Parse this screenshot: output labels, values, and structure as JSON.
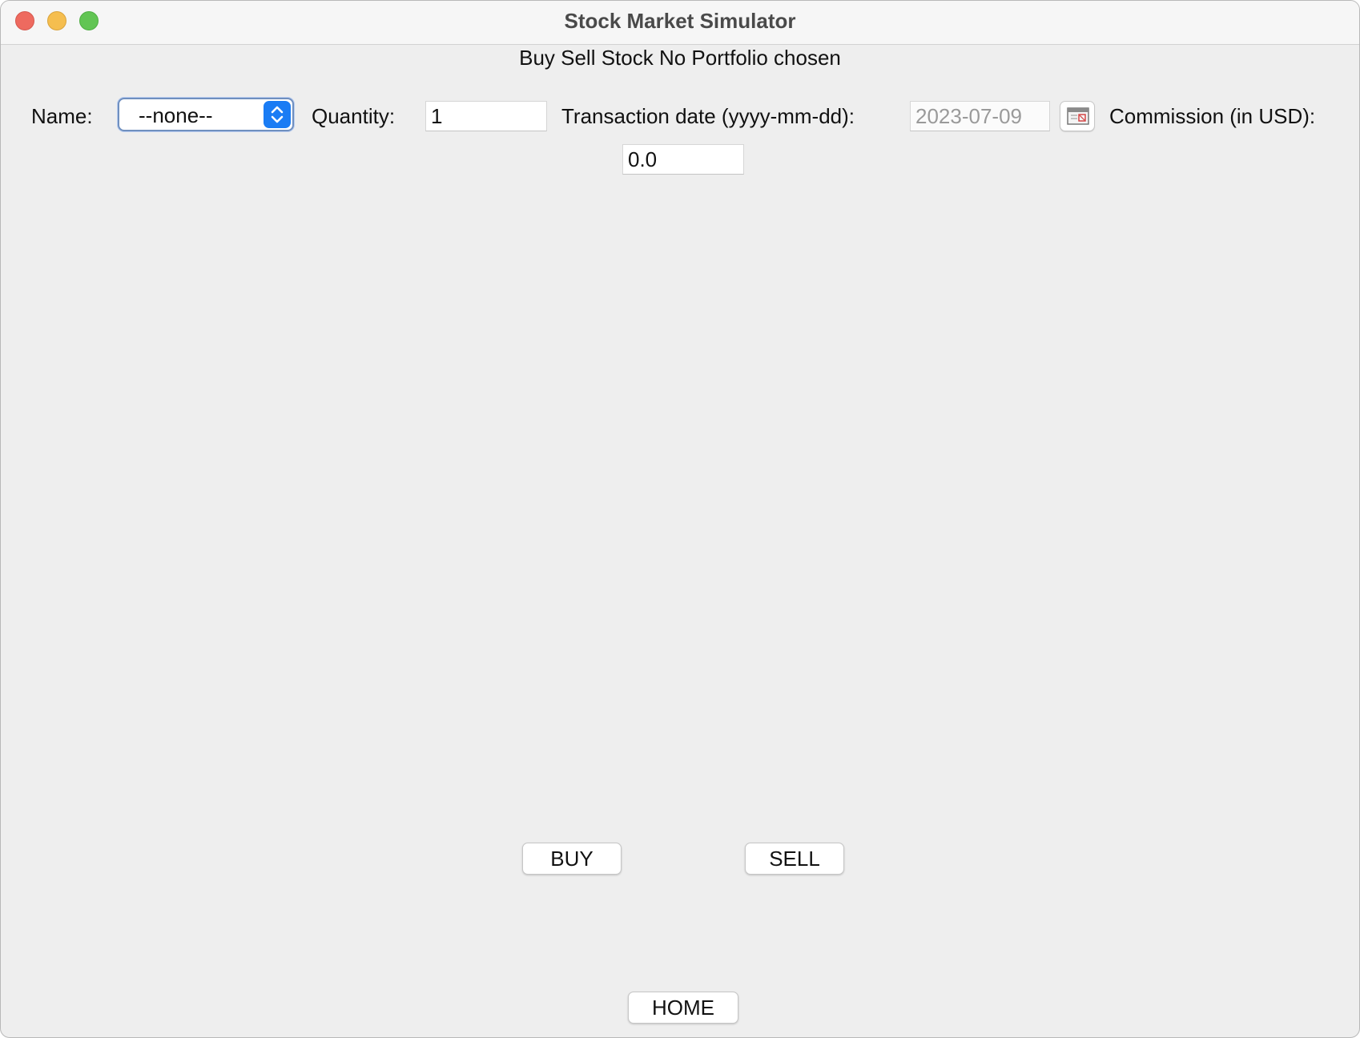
{
  "window": {
    "title": "Stock Market Simulator"
  },
  "header": {
    "subtitle": "Buy Sell Stock No Portfolio chosen"
  },
  "form": {
    "name_label": "Name:",
    "name_selected": "--none--",
    "quantity_label": "Quantity:",
    "quantity_value": "1",
    "date_label": "Transaction date (yyyy-mm-dd):",
    "date_value": "2023-07-09",
    "commission_label": "Commission (in USD):",
    "commission_value": "0.0"
  },
  "actions": {
    "buy_label": "BUY",
    "sell_label": "SELL",
    "home_label": "HOME"
  },
  "colors": {
    "window_background": "#eeeeee",
    "select_accent": "#1a7cf4",
    "close": "#ee6a5f",
    "minimize": "#f5be4f",
    "zoom": "#62c554"
  },
  "icons": {
    "select": "chevron-up-down-icon",
    "date_picker": "calendar-icon"
  }
}
